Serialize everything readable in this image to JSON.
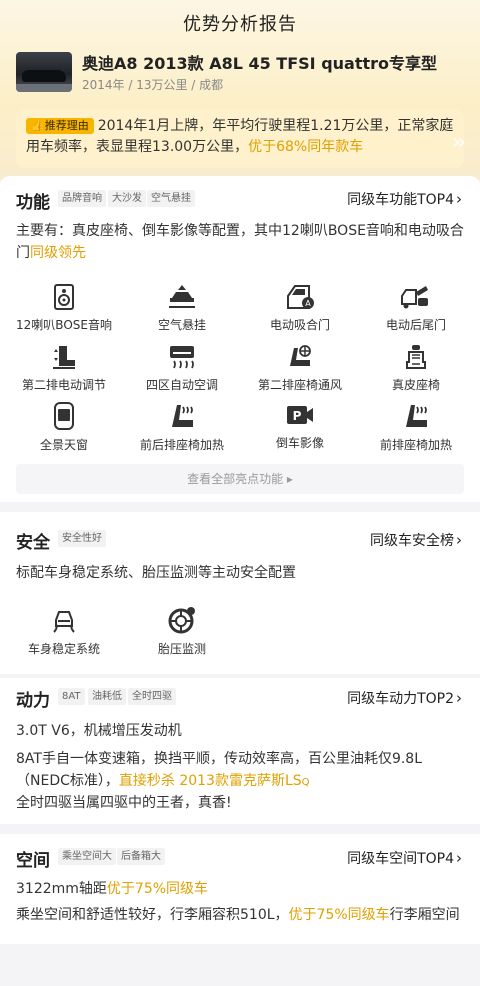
{
  "header": {
    "title": "优势分析报告"
  },
  "car": {
    "name": "奥迪A8 2013款 A8L 45 TFSI quattro专享型",
    "meta": "2014年 / 13万公里 / 成都"
  },
  "reason": {
    "badge": "推荐理由",
    "text_main": "2014年1月上牌，年平均行驶里程1.21万公里，正常家庭用车频率，表显里程13.00万公里，",
    "text_highlight": "优于68%同年款车"
  },
  "colors": {
    "accent": "#f7b500",
    "highlight": "#e0a000",
    "hero_bg": "#fcefc7"
  },
  "features": {
    "title": "功能",
    "tags": [
      "品牌音响",
      "大沙发",
      "空气悬挂"
    ],
    "rank_label": "同级车功能TOP4",
    "desc": "主要有：真皮座椅、倒车影像等配置，其中12喇叭BOSE音响和电动吸合门",
    "desc_highlight": "同级领先",
    "items": [
      {
        "label": "12喇叭BOSE音响",
        "icon": "speaker-icon"
      },
      {
        "label": "空气悬挂",
        "icon": "air-suspension-icon"
      },
      {
        "label": "电动吸合门",
        "icon": "soft-close-door-icon"
      },
      {
        "label": "电动后尾门",
        "icon": "power-tailgate-icon"
      },
      {
        "label": "第二排电动调节",
        "icon": "rear-seat-adjust-icon"
      },
      {
        "label": "四区自动空调",
        "icon": "climate-control-icon"
      },
      {
        "label": "第二排座椅通风",
        "icon": "seat-ventilation-icon"
      },
      {
        "label": "真皮座椅",
        "icon": "leather-seat-icon"
      },
      {
        "label": "全景天窗",
        "icon": "panoramic-sunroof-icon"
      },
      {
        "label": "前后排座椅加热",
        "icon": "seat-heating-icon"
      },
      {
        "label": "倒车影像",
        "icon": "rear-camera-icon"
      },
      {
        "label": "前排座椅加热",
        "icon": "front-seat-heating-icon"
      }
    ],
    "more_label": "查看全部亮点功能 ▸"
  },
  "safety": {
    "title": "安全",
    "tags": [
      "安全性好"
    ],
    "rank_label": "同级车安全榜",
    "desc": "标配车身稳定系统、胎压监测等主动安全配置",
    "items": [
      {
        "label": "车身稳定系统",
        "icon": "stability-control-icon"
      },
      {
        "label": "胎压监测",
        "icon": "tire-pressure-icon"
      }
    ]
  },
  "power": {
    "title": "动力",
    "tags": [
      "8AT",
      "油耗低",
      "全时四驱"
    ],
    "rank_label": "同级车动力TOP2",
    "line1": "3.0T V6，机械增压发动机",
    "line2_main": "8AT手自一体变速箱，换挡平顺，传动效率高，百公里油耗仅9.8L（NEDC标准），",
    "line2_highlight": "直接秒杀 2013款雷克萨斯LS",
    "line3": "全时四驱当属四驱中的王者，真香!"
  },
  "space": {
    "title": "空间",
    "tags": [
      "乘坐空间大",
      "后备箱大"
    ],
    "rank_label": "同级车空间TOP4",
    "line1_main": "3122mm轴距",
    "line1_highlight": "优于75%同级车",
    "line2_main": "乘坐空间和舒适性较好，行李厢容积510L，",
    "line2_highlight": "优于75%同级车",
    "line2_tail": "行李厢空间"
  },
  "glyphs": {
    "chevron": "›",
    "search": "Q"
  }
}
